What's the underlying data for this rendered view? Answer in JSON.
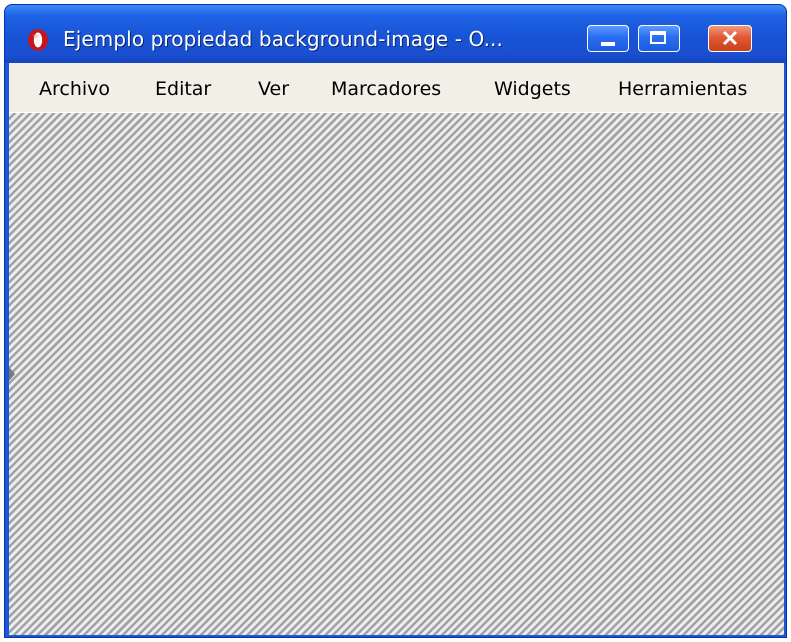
{
  "window": {
    "title": "Ejemplo propiedad background-image - O..."
  },
  "title_buttons": {
    "minimize_icon": "minimize-icon",
    "maximize_icon": "maximize-icon",
    "close_icon": "close-icon"
  },
  "menu": {
    "items": [
      {
        "label": "Archivo"
      },
      {
        "label": "Editar"
      },
      {
        "label": "Ver"
      },
      {
        "label": "Marcadores"
      },
      {
        "label": "Widgets"
      },
      {
        "label": "Herramientas"
      }
    ]
  },
  "colors": {
    "titlebar": "#1f5fe0",
    "close_button": "#e15a35",
    "menubar": "#f1efe6",
    "stripe_light": "#ececec",
    "stripe_dark": "#a2a2a2"
  }
}
